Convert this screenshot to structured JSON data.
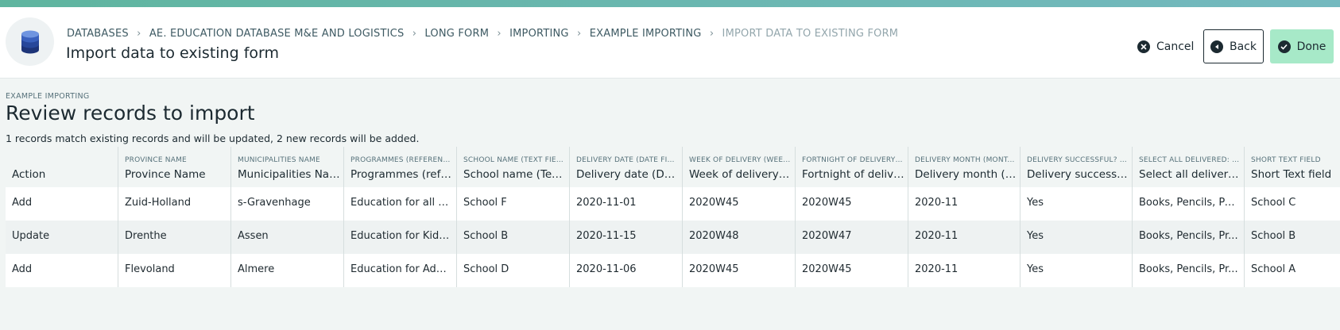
{
  "header": {
    "breadcrumb": [
      "DATABASES",
      "AE. EDUCATION DATABASE M&E AND LOGISTICS",
      "LONG FORM",
      "IMPORTING",
      "EXAMPLE IMPORTING",
      "IMPORT DATA TO EXISTING FORM"
    ],
    "title": "Import data to existing form",
    "buttons": {
      "cancel": "Cancel",
      "back": "Back",
      "done": "Done"
    }
  },
  "review": {
    "section_label": "EXAMPLE IMPORTING",
    "title": "Review records to import",
    "summary": "1 records match existing records and will be updated, 2 new records will be added."
  },
  "table": {
    "columns": [
      {
        "sub": "",
        "label": "Action"
      },
      {
        "sub": "PROVINCE NAME",
        "label": "Province Name"
      },
      {
        "sub": "MUNICIPALITIES NAME",
        "label": "Municipalities Name"
      },
      {
        "sub": "PROGRAMMES (REFERENC...",
        "label": "Programmes (refer..."
      },
      {
        "sub": "SCHOOL NAME (TEXT FIELD)",
        "label": "School name (Text ..."
      },
      {
        "sub": "DELIVERY DATE (DATE FIE...",
        "label": "Delivery date (Date..."
      },
      {
        "sub": "WEEK OF DELIVERY (WEE...",
        "label": "Week of delivery (..."
      },
      {
        "sub": "FORTNIGHT OF DELIVERY ...",
        "label": "Fortnight of deliver..."
      },
      {
        "sub": "DELIVERY MONTH (MONT...",
        "label": "Delivery month (M..."
      },
      {
        "sub": "DELIVERY SUCCESSFUL? (S...",
        "label": "Delivery successful..."
      },
      {
        "sub": "SELECT ALL DELIVERED: (...",
        "label": "Select all delivered:..."
      },
      {
        "sub": "SHORT TEXT FIELD",
        "label": "Short Text field"
      }
    ],
    "rows": [
      [
        "Add",
        "Zuid-Holland",
        "s-Gravenhage",
        "Education for all 2...",
        "School F",
        "2020-11-01",
        "2020W45",
        "2020W45",
        "2020-11",
        "Yes",
        "Books, Pencils, Pa...",
        "School C"
      ],
      [
        "Update",
        "Drenthe",
        "Assen",
        "Education for Kids...",
        "School B",
        "2020-11-15",
        "2020W48",
        "2020W47",
        "2020-11",
        "Yes",
        "Books, Pencils, Pr...",
        "School B"
      ],
      [
        "Add",
        "Flevoland",
        "Almere",
        "Education for Adu...",
        "School D",
        "2020-11-06",
        "2020W45",
        "2020W45",
        "2020-11",
        "Yes",
        "Books, Pencils, Pr...",
        "School A"
      ]
    ]
  },
  "icons": {
    "database": "database-icon",
    "chevron": "chevron-right-icon",
    "cancel": "close-circle-icon",
    "back": "arrow-left-circle-icon",
    "done": "check-circle-icon"
  },
  "colors": {
    "accent_bar": "#5fb59f",
    "done_button": "#a7e9c8",
    "database_icon": "#2f4e9e"
  }
}
